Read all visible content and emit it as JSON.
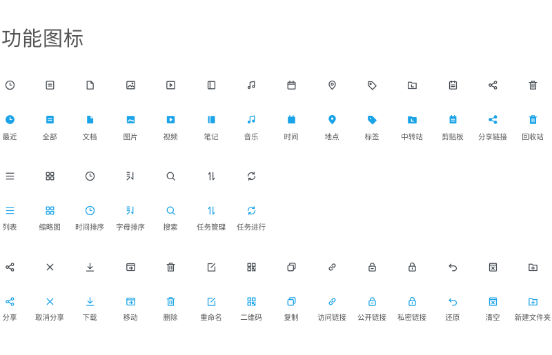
{
  "title": "功能图标",
  "colors": {
    "outline": "#444a50",
    "accent": "#1aa3e8",
    "label": "#555555"
  },
  "groups": [
    {
      "style": "filled",
      "icons": [
        {
          "name": "clock-icon",
          "label": "最近"
        },
        {
          "name": "document-list-icon",
          "label": "全部"
        },
        {
          "name": "file-icon",
          "label": "文档"
        },
        {
          "name": "image-icon",
          "label": "图片"
        },
        {
          "name": "video-icon",
          "label": "视频"
        },
        {
          "name": "notebook-icon",
          "label": "笔记"
        },
        {
          "name": "music-icon",
          "label": "音乐"
        },
        {
          "name": "calendar-icon",
          "label": "时间"
        },
        {
          "name": "location-pin-icon",
          "label": "地点"
        },
        {
          "name": "tag-icon",
          "label": "标签"
        },
        {
          "name": "transfer-folder-icon",
          "label": "中转站"
        },
        {
          "name": "clipboard-icon",
          "label": "剪贴板"
        },
        {
          "name": "share-link-icon",
          "label": "分享链接"
        },
        {
          "name": "trash-icon",
          "label": "回收站"
        }
      ]
    },
    {
      "style": "blue",
      "icons": [
        {
          "name": "list-icon",
          "label": "列表"
        },
        {
          "name": "grid-icon",
          "label": "缩略图"
        },
        {
          "name": "clock-sort-icon",
          "label": "时间排序"
        },
        {
          "name": "alpha-sort-icon",
          "label": "字母排序"
        },
        {
          "name": "search-icon",
          "label": "搜索"
        },
        {
          "name": "transfer-arrows-icon",
          "label": "任务管理"
        },
        {
          "name": "sync-icon",
          "label": "任务进行"
        }
      ]
    },
    {
      "style": "blue",
      "icons": [
        {
          "name": "share-icon",
          "label": "分享"
        },
        {
          "name": "close-icon",
          "label": "取消分享"
        },
        {
          "name": "download-icon",
          "label": "下载"
        },
        {
          "name": "move-icon",
          "label": "移动"
        },
        {
          "name": "delete-icon",
          "label": "删除"
        },
        {
          "name": "rename-icon",
          "label": "重命名"
        },
        {
          "name": "qrcode-icon",
          "label": "二维码"
        },
        {
          "name": "copy-icon",
          "label": "复制"
        },
        {
          "name": "access-link-icon",
          "label": "访问链接"
        },
        {
          "name": "public-link-icon",
          "label": "公开链接"
        },
        {
          "name": "private-link-icon",
          "label": "私密链接"
        },
        {
          "name": "restore-icon",
          "label": "还原"
        },
        {
          "name": "clear-icon",
          "label": "清空"
        },
        {
          "name": "new-folder-icon",
          "label": "新建文件夹"
        }
      ]
    }
  ]
}
